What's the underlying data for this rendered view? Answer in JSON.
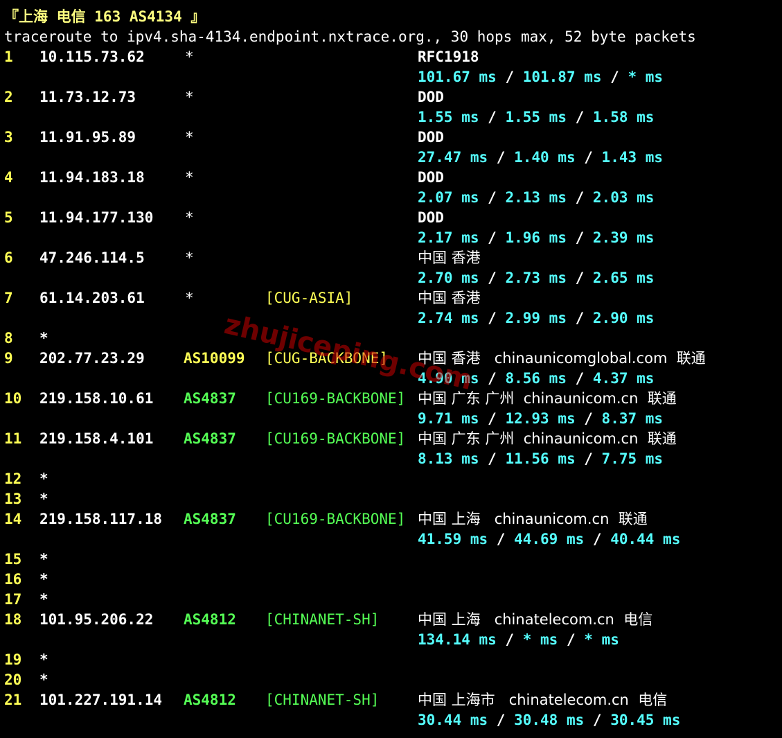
{
  "header": {
    "title": "『上海 电信 163 AS4134 』",
    "command": "traceroute to ipv4.sha-4134.endpoint.nxtrace.org., 30 hops max, 52 byte packets"
  },
  "watermark": "zhujiceping.com",
  "colors": {
    "hop": "#ffff55",
    "asn_yellow": "#ffff55",
    "asn_green": "#55ff55",
    "rtt": "#55ffff",
    "background": "#000000"
  },
  "hops": [
    {
      "n": "1",
      "ip": "10.115.73.62",
      "asn": "*",
      "tag": "",
      "loc": "RFC1918",
      "rtt": [
        "101.67",
        "101.87",
        "*"
      ]
    },
    {
      "n": "2",
      "ip": "11.73.12.73",
      "asn": "*",
      "tag": "",
      "loc": "DOD",
      "rtt": [
        "1.55",
        "1.55",
        "1.58"
      ]
    },
    {
      "n": "3",
      "ip": "11.91.95.89",
      "asn": "*",
      "tag": "",
      "loc": "DOD",
      "rtt": [
        "27.47",
        "1.40",
        "1.43"
      ]
    },
    {
      "n": "4",
      "ip": "11.94.183.18",
      "asn": "*",
      "tag": "",
      "loc": "DOD",
      "rtt": [
        "2.07",
        "2.13",
        "2.03"
      ]
    },
    {
      "n": "5",
      "ip": "11.94.177.130",
      "asn": "*",
      "tag": "",
      "loc": "DOD",
      "rtt": [
        "2.17",
        "1.96",
        "2.39"
      ]
    },
    {
      "n": "6",
      "ip": "47.246.114.5",
      "asn": "*",
      "tag": "",
      "loc": "中国 香港",
      "rtt": [
        "2.70",
        "2.73",
        "2.65"
      ]
    },
    {
      "n": "7",
      "ip": "61.14.203.61",
      "asn": "*",
      "tag": "[CUG-ASIA]",
      "loc": "中国 香港",
      "rtt": [
        "2.74",
        "2.99",
        "2.90"
      ]
    },
    {
      "n": "8",
      "timeout": "*"
    },
    {
      "n": "9",
      "ip": "202.77.23.29",
      "asn": "AS10099",
      "tag": "[CUG-BACKBONE]",
      "loc": "中国 香港   chinaunicomglobal.com  联通",
      "rtt": [
        "4.90",
        "8.56",
        "4.37"
      ]
    },
    {
      "n": "10",
      "ip": "219.158.10.61",
      "asn": "AS4837",
      "tag": "[CU169-BACKBONE]",
      "loc": "中国 广东 广州  chinaunicom.cn  联通",
      "rtt": [
        "9.71",
        "12.93",
        "8.37"
      ]
    },
    {
      "n": "11",
      "ip": "219.158.4.101",
      "asn": "AS4837",
      "tag": "[CU169-BACKBONE]",
      "loc": "中国 广东 广州  chinaunicom.cn  联通",
      "rtt": [
        "8.13",
        "11.56",
        "7.75"
      ]
    },
    {
      "n": "12",
      "timeout": "*"
    },
    {
      "n": "13",
      "timeout": "*"
    },
    {
      "n": "14",
      "ip": "219.158.117.18",
      "asn": "AS4837",
      "tag": "[CU169-BACKBONE]",
      "loc": "中国 上海   chinaunicom.cn  联通",
      "rtt": [
        "41.59",
        "44.69",
        "40.44"
      ]
    },
    {
      "n": "15",
      "timeout": "*"
    },
    {
      "n": "16",
      "timeout": "*"
    },
    {
      "n": "17",
      "timeout": "*"
    },
    {
      "n": "18",
      "ip": "101.95.206.22",
      "asn": "AS4812",
      "tag": "[CHINANET-SH]",
      "loc": "中国 上海   chinatelecom.cn  电信",
      "rtt": [
        "134.14",
        "*",
        "*"
      ]
    },
    {
      "n": "19",
      "timeout": "*"
    },
    {
      "n": "20",
      "timeout": "*"
    },
    {
      "n": "21",
      "ip": "101.227.191.14",
      "asn": "AS4812",
      "tag": "[CHINANET-SH]",
      "loc": "中国 上海市   chinatelecom.cn  电信",
      "rtt": [
        "30.44",
        "30.48",
        "30.45"
      ]
    }
  ]
}
